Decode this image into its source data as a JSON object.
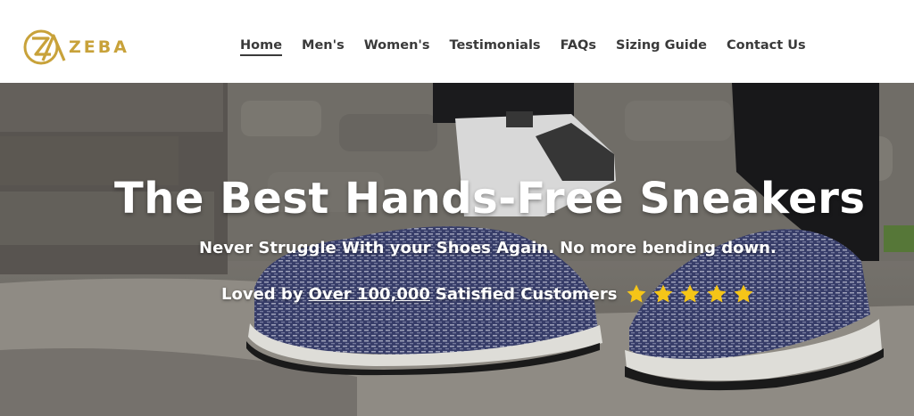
{
  "brand": {
    "name": "ZEBA",
    "color": "#c8a23a",
    "logo_icon": "zeba-logo-icon"
  },
  "nav": {
    "items": [
      {
        "label": "Home",
        "active": true
      },
      {
        "label": "Men's"
      },
      {
        "label": "Women's"
      },
      {
        "label": "Testimonials"
      },
      {
        "label": "FAQs"
      },
      {
        "label": "Sizing Guide"
      },
      {
        "label": "Contact Us"
      }
    ]
  },
  "hero": {
    "title": "The Best Hands-Free Sneakers",
    "subtitle": "Never Struggle With your Shoes Again. No more bending down.",
    "loved_prefix": "Loved by",
    "loved_link": "Over 100,000",
    "loved_suffix": "Satisfied Customers",
    "rating": {
      "stars": 5,
      "max": 5,
      "star_color": "#f5c518",
      "icon": "star-icon"
    },
    "image": "sneakers-on-feet-photo"
  }
}
